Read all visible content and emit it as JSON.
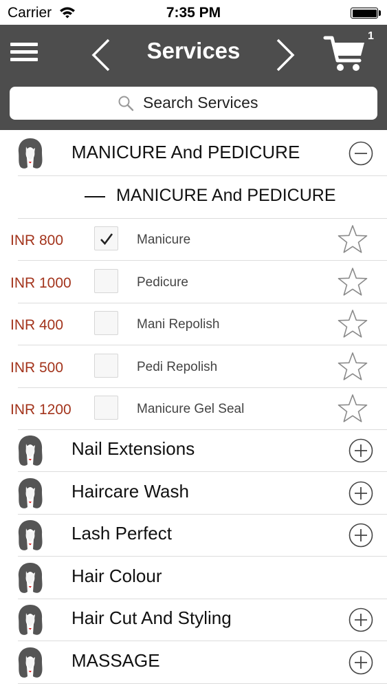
{
  "status_bar": {
    "carrier": "Carrier",
    "time": "7:35 PM"
  },
  "header": {
    "title": "Services",
    "cart_count": "1"
  },
  "search": {
    "placeholder": "Search Services"
  },
  "expanded_category": {
    "name": "MANICURE  And PEDICURE",
    "subheading": "MANICURE  And PEDICURE"
  },
  "services": [
    {
      "price": "INR 800",
      "name": "Manicure",
      "checked": true
    },
    {
      "price": "INR 1000",
      "name": "Pedicure",
      "checked": false
    },
    {
      "price": "INR 400",
      "name": "Mani Repolish",
      "checked": false
    },
    {
      "price": "INR 500",
      "name": "Pedi Repolish",
      "checked": false
    },
    {
      "price": "INR 1200",
      "name": "Manicure Gel Seal",
      "checked": false
    }
  ],
  "categories": [
    {
      "name": "Nail Extensions",
      "expand_icon": true
    },
    {
      "name": "Haircare  Wash",
      "expand_icon": true
    },
    {
      "name": "Lash Perfect",
      "expand_icon": true
    },
    {
      "name": "Hair Colour",
      "expand_icon": false
    },
    {
      "name": "Hair Cut And Styling",
      "expand_icon": true
    },
    {
      "name": "MASSAGE",
      "expand_icon": true
    }
  ],
  "colors": {
    "header_bg": "#4d4d4d",
    "price": "#a3341c"
  }
}
